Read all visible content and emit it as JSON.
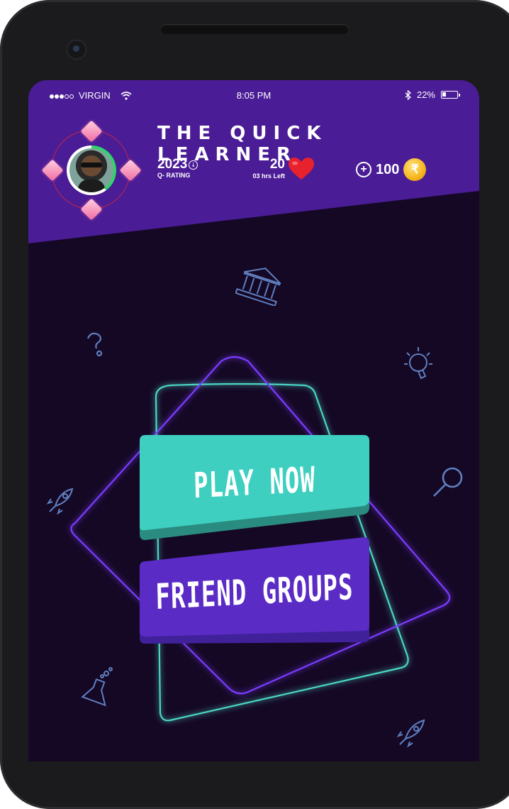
{
  "status_bar": {
    "carrier": "VIRGIN",
    "time": "8:05 PM",
    "battery": "22%"
  },
  "profile": {
    "title": "THE QUICK LEARNER",
    "rating_value": "2023",
    "rating_label": "Q- RATING",
    "lives_value": "20",
    "lives_label": "03 hrs Left",
    "coins_value": "100",
    "coin_symbol": "₹"
  },
  "actions": {
    "play_now": "PLAY NOW",
    "friend_groups": "FRIEND GROUPS"
  },
  "colors": {
    "header": "#4a1c95",
    "background": "#150825",
    "play_button": "#3ecfc0",
    "friend_button": "#5b2bc5",
    "heart": "#e8222c",
    "coin": "#f5b51d"
  },
  "icons": [
    "wifi-icon",
    "bluetooth-icon",
    "battery-icon",
    "info-icon",
    "heart-icon",
    "plus-icon",
    "rupee-coin-icon",
    "gem-icon",
    "bank-icon",
    "question-icon",
    "lightbulb-icon",
    "magnifier-icon",
    "rocket-icon",
    "flask-icon"
  ]
}
